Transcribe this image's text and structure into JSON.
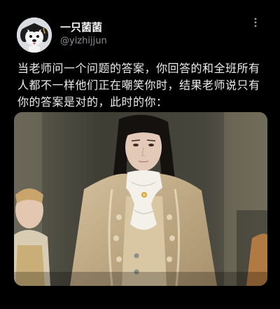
{
  "post": {
    "author": {
      "display_name": "一只菌菌",
      "handle": "@yizhijjun",
      "avatar_icon": "cartoon-dog-avatar-icon"
    },
    "more_icon": "more-options-icon",
    "text": "当老师问一个问题的答案，你回答的和全班所有人都不一样他们正在嘲笑你时，结果老师说只有你的答案是对的，此时的你：",
    "media": {
      "type": "image",
      "subject": "man-in-ornate-period-costume",
      "colors": {
        "background": "#4c4a3f",
        "coat": "#c7b18e",
        "hair": "#151210",
        "skin": "#e3c9b8"
      }
    }
  }
}
